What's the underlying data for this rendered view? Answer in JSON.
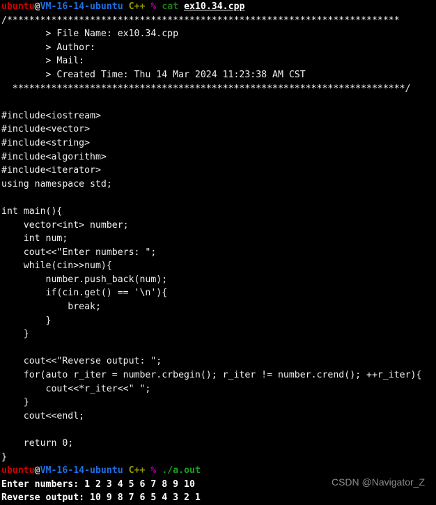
{
  "terminal": {
    "background_color": "#000000",
    "default_text_color": "#ffffff",
    "prompt": {
      "user": "ubuntu",
      "at": "@",
      "host": "VM-16-14-ubuntu",
      "context": "C++",
      "symbol": "%",
      "user_color": "#cc0000",
      "host_color": "#1d6fe0",
      "context_color": "#9a9a00",
      "symbol_color": "#a000a0",
      "command_color": "#1b7a1b"
    },
    "command_1": {
      "name": "cat",
      "argument": "ex10.34.cpp"
    },
    "command_2": {
      "name": "./a.out"
    },
    "file_header": {
      "top_rule": "/***********************************************************************",
      "rows": [
        "        > File Name: ex10.34.cpp",
        "        > Author: ",
        "        > Mail: ",
        "        > Created Time: Thu 14 Mar 2024 11:23:38 AM CST"
      ],
      "bottom_rule": "  ***********************************************************************/"
    },
    "source_lines": [
      "",
      "#include<iostream>",
      "#include<vector>",
      "#include<string>",
      "#include<algorithm>",
      "#include<iterator>",
      "using namespace std;",
      "",
      "int main(){",
      "    vector<int> number;",
      "    int num;",
      "    cout<<\"Enter numbers: \";",
      "    while(cin>>num){",
      "        number.push_back(num);",
      "        if(cin.get() == '\\n'){",
      "            break;",
      "        }",
      "    }",
      "",
      "    cout<<\"Reverse output: \";",
      "    for(auto r_iter = number.crbegin(); r_iter != number.crend(); ++r_iter){",
      "        cout<<*r_iter<<\" \";",
      "    }",
      "    cout<<endl;",
      "",
      "    return 0;",
      "}"
    ],
    "program_output": [
      "Enter numbers: 1 2 3 4 5 6 7 8 9 10",
      "Reverse output: 10 9 8 7 6 5 4 3 2 1"
    ]
  },
  "watermark": {
    "text": "CSDN @Navigator_Z"
  }
}
